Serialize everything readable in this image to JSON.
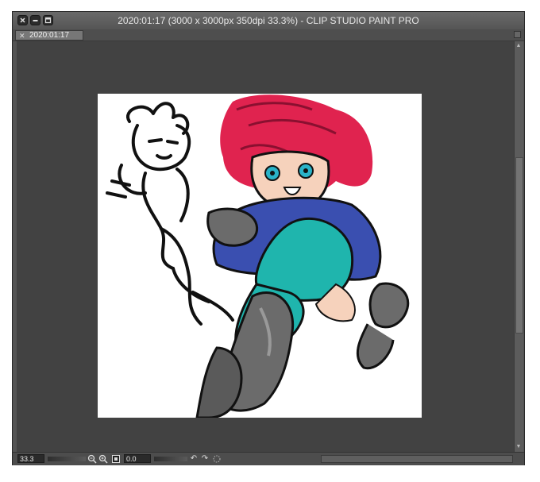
{
  "window": {
    "title": "2020:01:17 (3000 x 3000px 350dpi 33.3%)  - CLIP STUDIO PAINT PRO"
  },
  "tabs": [
    {
      "label": "2020:01:17",
      "close": "✕"
    }
  ],
  "status": {
    "zoom_value": "33.3",
    "angle_value": "0.0"
  },
  "icons": {
    "close": "close-icon",
    "minimize": "minimize-icon",
    "maximize": "maximize-icon",
    "zoom_out": "zoom-out-icon",
    "zoom_in": "zoom-in-icon",
    "fit": "fit-to-window-icon",
    "rotate_left": "rotate-left-icon",
    "rotate_right": "rotate-right-icon",
    "reset": "reset-rotation-icon"
  },
  "colors": {
    "ui_background": "#545454",
    "canvas_surround": "#424242",
    "hair": "#e0234f",
    "jacket": "#3a4fb0",
    "pants": "#1fb5ad",
    "boots": "#6b6b6b",
    "skin": "#f6d2bc"
  }
}
